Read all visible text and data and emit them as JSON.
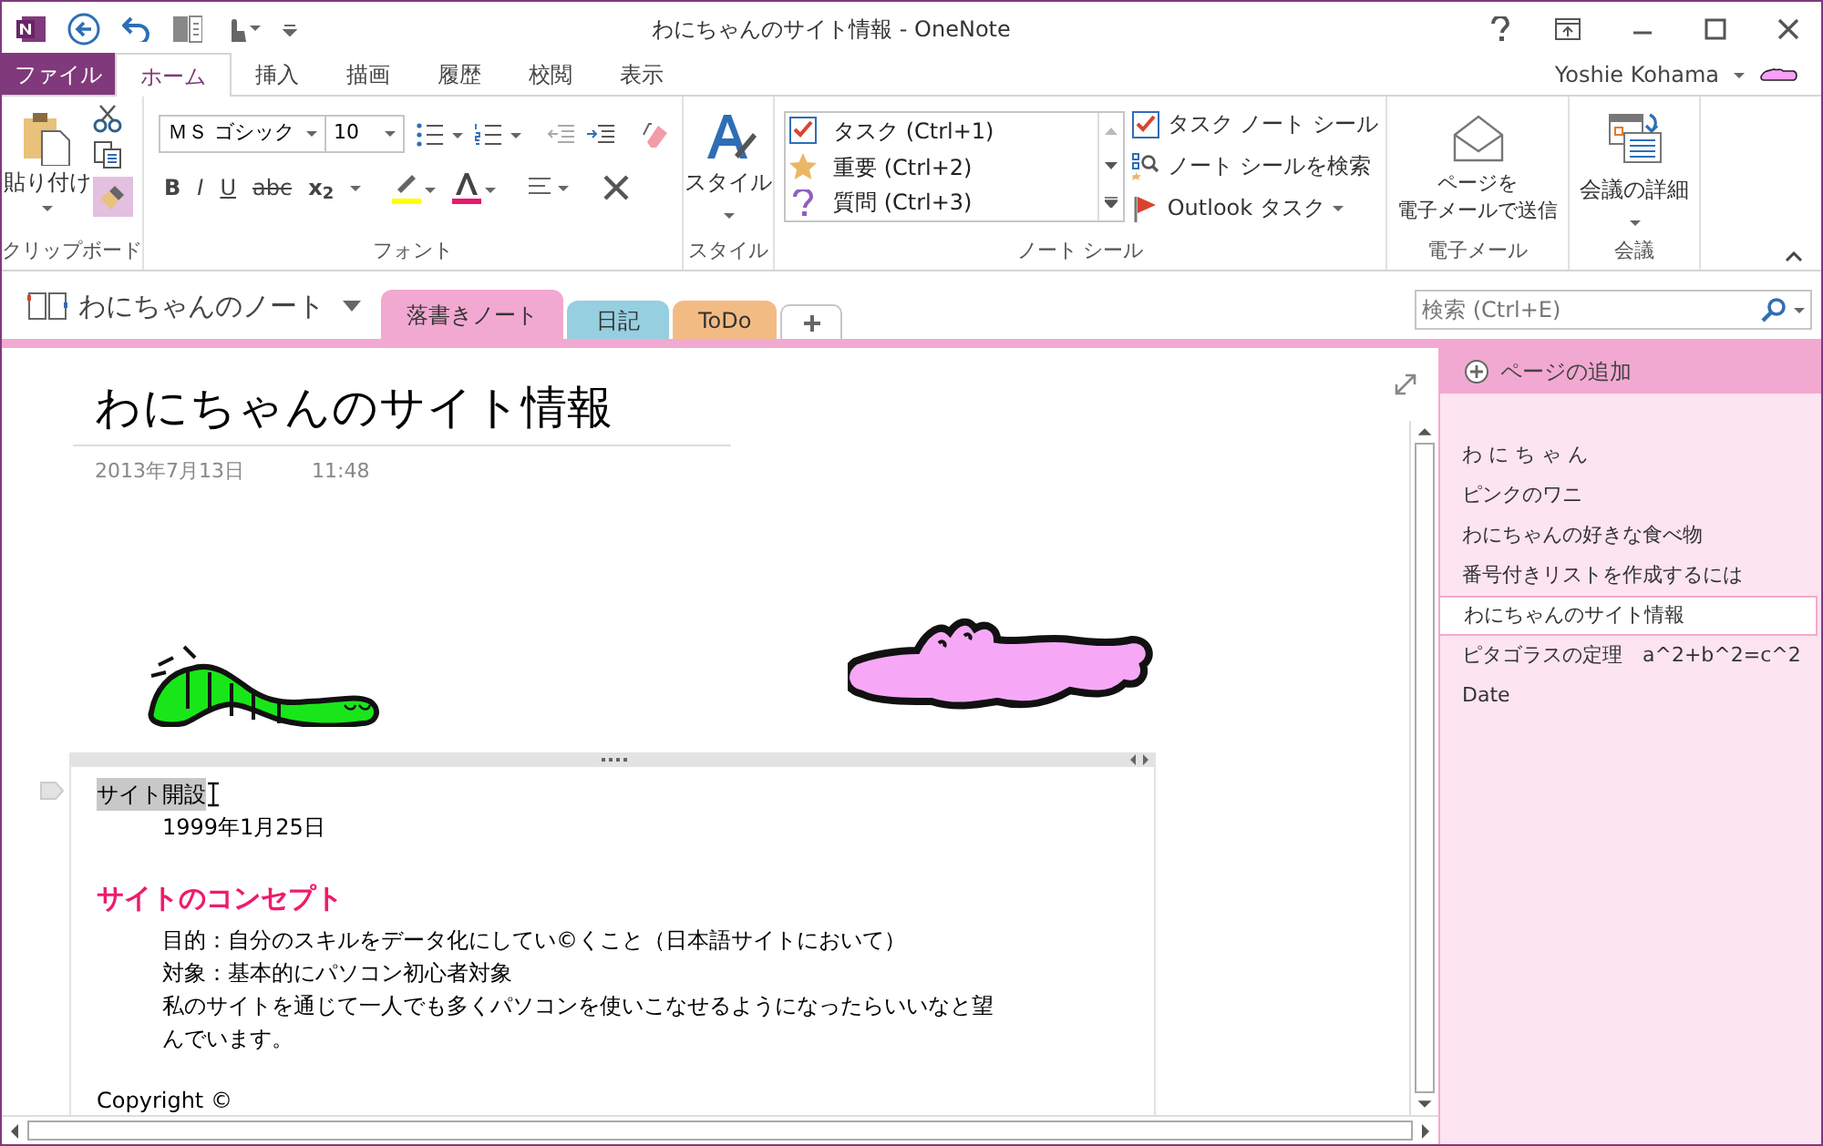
{
  "window": {
    "title": "わにちゃんのサイト情報 - OneNote"
  },
  "user": {
    "name": "Yoshie Kohama"
  },
  "ribbon_tabs": [
    {
      "label": "ファイル",
      "kind": "file",
      "selected": false
    },
    {
      "label": "ホーム",
      "kind": "tab",
      "selected": true
    },
    {
      "label": "挿入",
      "kind": "tab",
      "selected": false
    },
    {
      "label": "描画",
      "kind": "tab",
      "selected": false
    },
    {
      "label": "履歴",
      "kind": "tab",
      "selected": false
    },
    {
      "label": "校閲",
      "kind": "tab",
      "selected": false
    },
    {
      "label": "表示",
      "kind": "tab",
      "selected": false
    }
  ],
  "ribbon": {
    "clipboard": {
      "paste": "貼り付け",
      "label": "クリップボード"
    },
    "font": {
      "name": "ＭＳ ゴシック",
      "size": "10",
      "format_buttons": [
        "B",
        "I",
        "U",
        "abc",
        "x$_{2}$"
      ],
      "label": "フォント"
    },
    "styles": {
      "button": "スタイル",
      "label": "スタイル"
    },
    "tags": {
      "items": [
        {
          "label": "タスク (Ctrl+1)",
          "kind": "check"
        },
        {
          "label": "重要 (Ctrl+2)",
          "kind": "star"
        },
        {
          "label": "質問 (Ctrl+3)",
          "kind": "question"
        }
      ],
      "task_tag": "タスク ノート シール",
      "find_tags": "ノート シールを検索",
      "outlook_tasks": "Outlook タスク",
      "label": "ノート シール"
    },
    "email": {
      "button_lines": [
        "ページを",
        "電子メールで送信"
      ],
      "label": "電子メール"
    },
    "meetings": {
      "button": "会議の詳細",
      "label": "会議"
    }
  },
  "notebook": {
    "name": "わにちゃんのノート"
  },
  "sections": [
    {
      "label": "落書きノート",
      "color": "#f2a9d1",
      "selected": true
    },
    {
      "label": "日記",
      "color": "#96cfe0",
      "selected": false
    },
    {
      "label": "ToDo",
      "color": "#f3bb84",
      "selected": false
    }
  ],
  "search": {
    "placeholder": "検索 (Ctrl+E)"
  },
  "page": {
    "title": "わにちゃんのサイト情報",
    "date": "2013年7月13日",
    "time": "11:48",
    "lines": [
      {
        "text": "サイト開設",
        "kind": "text",
        "indent": false,
        "selected": true
      },
      {
        "text": "1999年1月25日",
        "kind": "text",
        "indent": true,
        "selected": false
      },
      {
        "text": "サイトのコンセプト",
        "kind": "heading",
        "indent": false,
        "selected": false
      },
      {
        "text": "目的：自分のスキルをデータ化にしてい©くこと（日本語サイトにおいて）",
        "kind": "text",
        "indent": true,
        "selected": false
      },
      {
        "text": "対象：基本的にパソコン初心者対象",
        "kind": "text",
        "indent": true,
        "selected": false
      },
      {
        "text": "私のサイトを通じて一人でも多くパソコンを使いこなせるようになったらいいなと望んでいます。",
        "kind": "text",
        "indent": true,
        "selected": false
      },
      {
        "text": "Copyright ©",
        "kind": "text",
        "indent": false,
        "selected": false
      }
    ]
  },
  "page_list": {
    "add_page": "ページの追加",
    "pages": [
      {
        "title": "わ に ち ゃ ん",
        "selected": false
      },
      {
        "title": "ピンクのワニ",
        "selected": false
      },
      {
        "title": "わにちゃんの好きな食べ物",
        "selected": false
      },
      {
        "title": "番号付きリストを作成するには",
        "selected": false
      },
      {
        "title": "わにちゃんのサイト情報",
        "selected": true
      },
      {
        "title": "ピタゴラスの定理　a^2+b^2=c^2",
        "selected": false
      },
      {
        "title": "Date",
        "selected": false
      }
    ]
  }
}
